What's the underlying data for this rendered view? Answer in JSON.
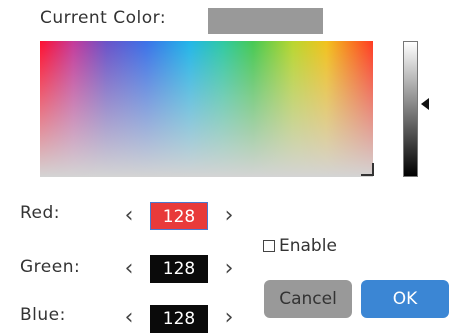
{
  "current_color": {
    "label": "Current Color:",
    "swatch_color": "#999999"
  },
  "brightness": {
    "marker_level": 0.46
  },
  "channels": [
    {
      "label": "Red:",
      "value": "128",
      "active": true,
      "box_color": "#e83a3a"
    },
    {
      "label": "Green:",
      "value": "128",
      "active": false,
      "box_color": "#0a0a0a"
    },
    {
      "label": "Blue:",
      "value": "128",
      "active": false,
      "box_color": "#0a0a0a"
    }
  ],
  "arrows": {
    "left": "‹",
    "right": "›"
  },
  "enable": {
    "label": "Enable",
    "checked": false
  },
  "buttons": {
    "cancel": "Cancel",
    "ok": "OK"
  },
  "colors": {
    "ok_button": "#3b86d4",
    "cancel_button": "#999999"
  }
}
